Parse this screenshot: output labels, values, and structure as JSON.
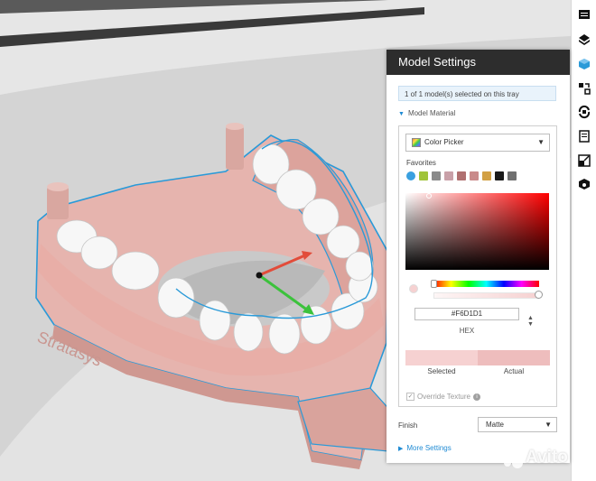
{
  "panel": {
    "title": "Model Settings",
    "selection_info": "1 of 1 model(s) selected on this tray",
    "material_section": "Model Material",
    "color_dropdown_value": "Color Picker",
    "favorites_label": "Favorites",
    "hex_value": "#F6D1D1",
    "hex_label": "HEX",
    "selected_label": "Selected",
    "actual_label": "Actual",
    "override_label": "Override Texture",
    "finish_label": "Finish",
    "finish_value": "Matte",
    "more_settings": "More Settings"
  },
  "colors": {
    "accent": "#1f8bd4",
    "header_bg": "#2d2d2d",
    "selected_color": "#f6d1d1",
    "actual_color": "#eebdbd",
    "model_color": "#e9b9b4"
  },
  "favorites": [
    "#3aa0e0",
    "#a0c43a",
    "#8a8a8a",
    "#c9a0a8",
    "#b07070",
    "#c98a8a",
    "#d2a044",
    "#1a1a1a",
    "#707070"
  ],
  "toolbar_icons": [
    "layers-icon",
    "tray-icon",
    "model-icon",
    "arrange-icon",
    "rotate-icon",
    "notes-icon",
    "scale-icon",
    "material-icon"
  ],
  "model_emboss_text": "Stratasys",
  "watermark": "Avito"
}
